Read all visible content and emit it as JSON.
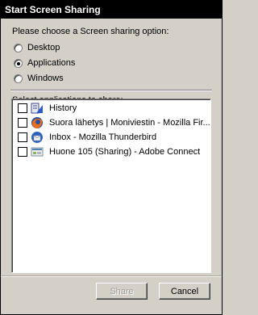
{
  "window": {
    "title": "Start Screen Sharing"
  },
  "options": {
    "prompt": "Please choose a Screen sharing option:",
    "radios": [
      {
        "label": "Desktop",
        "checked": false
      },
      {
        "label": "Applications",
        "checked": true
      },
      {
        "label": "Windows",
        "checked": false
      }
    ]
  },
  "apps": {
    "label": "Select applications to share:",
    "items": [
      {
        "label": "History",
        "icon": "history-icon",
        "checked": false
      },
      {
        "label": "Suora lähetys | Moniviestin - Mozilla Fir...",
        "icon": "firefox-icon",
        "checked": false
      },
      {
        "label": "Inbox - Mozilla Thunderbird",
        "icon": "thunderbird-icon",
        "checked": false
      },
      {
        "label": "Huone 105 (Sharing) - Adobe Connect",
        "icon": "adobe-connect-icon",
        "checked": false
      }
    ]
  },
  "buttons": {
    "share": "Share",
    "cancel": "Cancel",
    "share_disabled": true
  }
}
